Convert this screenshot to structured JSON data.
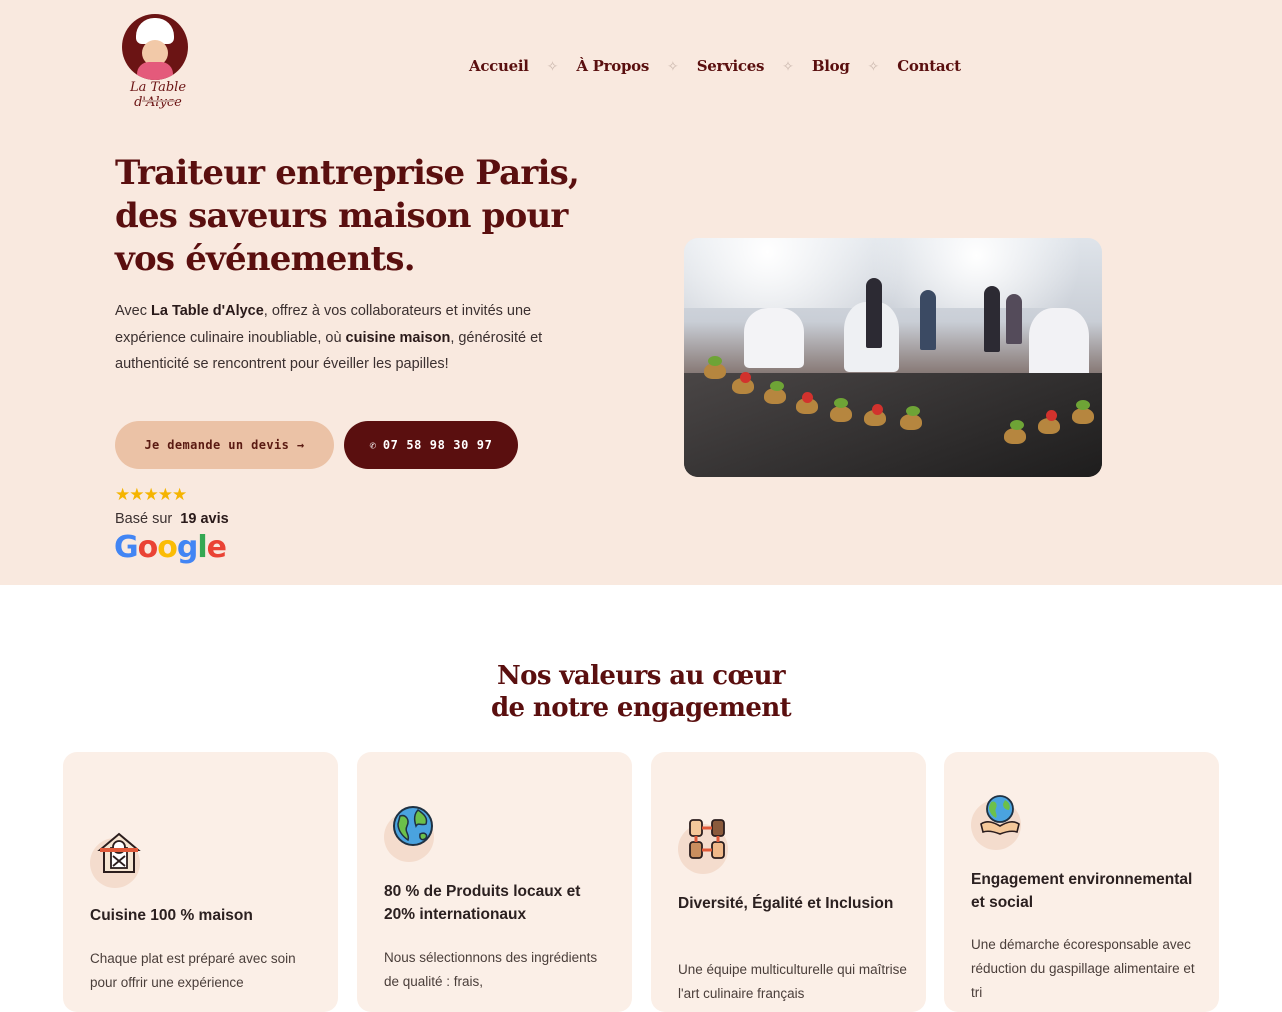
{
  "brand": {
    "logo_text": "La Table d'Alyce",
    "colors": {
      "primary": "#5a0f0f",
      "accent": "#ebc2a6",
      "background": "#f9e9df",
      "star": "#f5b400"
    }
  },
  "nav": {
    "items": [
      "Accueil",
      "À Propos",
      "Services",
      "Blog",
      "Contact"
    ],
    "separator": "✧"
  },
  "hero": {
    "title_line1": "Traiteur entreprise Paris,",
    "title_line2": "des saveurs maison pour",
    "title_line3": "vos événements.",
    "desc_part1": "Avec",
    "desc_brand": "La Table d'Alyce",
    "desc_part2": ", offrez à vos collaborateurs et invités une expérience culinaire inoubliable, où",
    "desc_bold": "cuisine maison",
    "desc_part3": ", générosité et authenticité se rencontrent pour éveiller les papilles!",
    "cta_quote": "Je demande un devis →",
    "cta_phone": "07 58 98 30 97",
    "phone_icon": "phone-icon",
    "image_alt": "buffet-event-photo"
  },
  "rating": {
    "stars": "★★★★★",
    "based_on": "Basé sur",
    "count": "19 avis",
    "provider": [
      "G",
      "o",
      "o",
      "g",
      "l",
      "e"
    ]
  },
  "values": {
    "title_line1": "Nos valeurs au cœur",
    "title_line2": "de notre engagement",
    "cards": [
      {
        "icon": "house-chef-icon",
        "title": "Cuisine 100 % maison",
        "text": "Chaque plat est préparé avec soin pour offrir une expérience"
      },
      {
        "icon": "globe-icon",
        "title": "80 % de Produits locaux et 20% internationaux",
        "text": "Nous sélectionnons des ingrédients de qualité : frais,"
      },
      {
        "icon": "diversity-hands-icon",
        "title": "Diversité, Égalité et Inclusion",
        "text": "Une équipe multiculturelle qui maîtrise l'art culinaire français"
      },
      {
        "icon": "earth-hands-icon",
        "title": "Engagement environnemental et social",
        "text": "Une démarche écoresponsable avec réduction du gaspillage alimentaire et tri"
      }
    ]
  }
}
